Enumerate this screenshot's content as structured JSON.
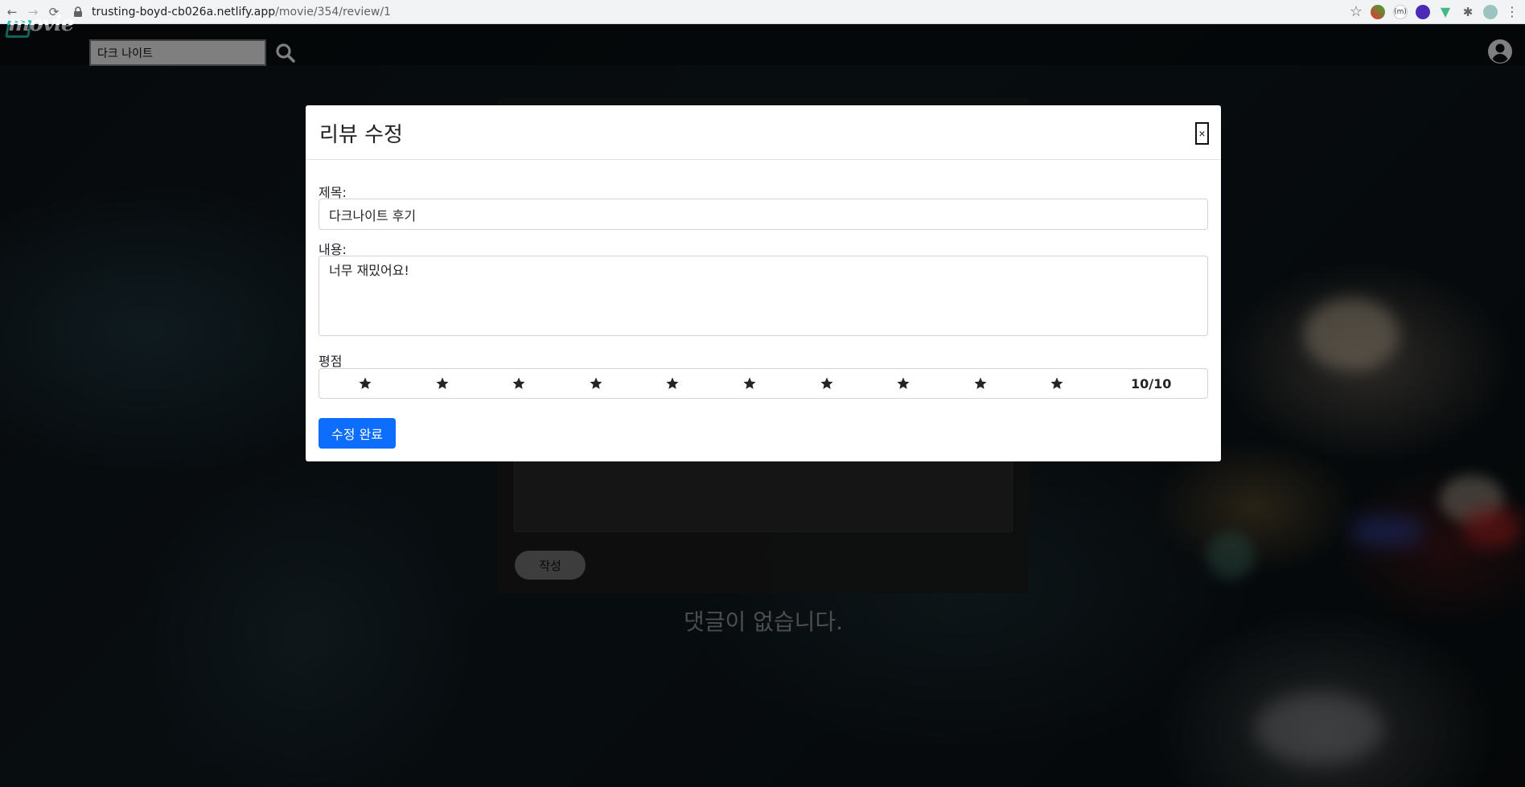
{
  "browser": {
    "url_host": "trusting-boyd-cb026a.netlify.app",
    "url_path": "/movie/354/review/1"
  },
  "site": {
    "logo_text": "movie",
    "search_value": "다크 나이트"
  },
  "background_page": {
    "submit_label": "작성",
    "no_comments_text": "댓글이 없습니다."
  },
  "modal": {
    "title": "리뷰 수정",
    "close_label": "×",
    "title_label": "제목:",
    "title_value": "다크나이트 후기",
    "content_label": "내용:",
    "content_value": "너무 재밌어요!",
    "rating_label": "평점",
    "rating_value": 10,
    "rating_max": 10,
    "rating_text": "10/10",
    "submit_label": "수정 완료"
  },
  "colors": {
    "primary": "#0d6efd",
    "logo_accent": "#25c2b9"
  }
}
